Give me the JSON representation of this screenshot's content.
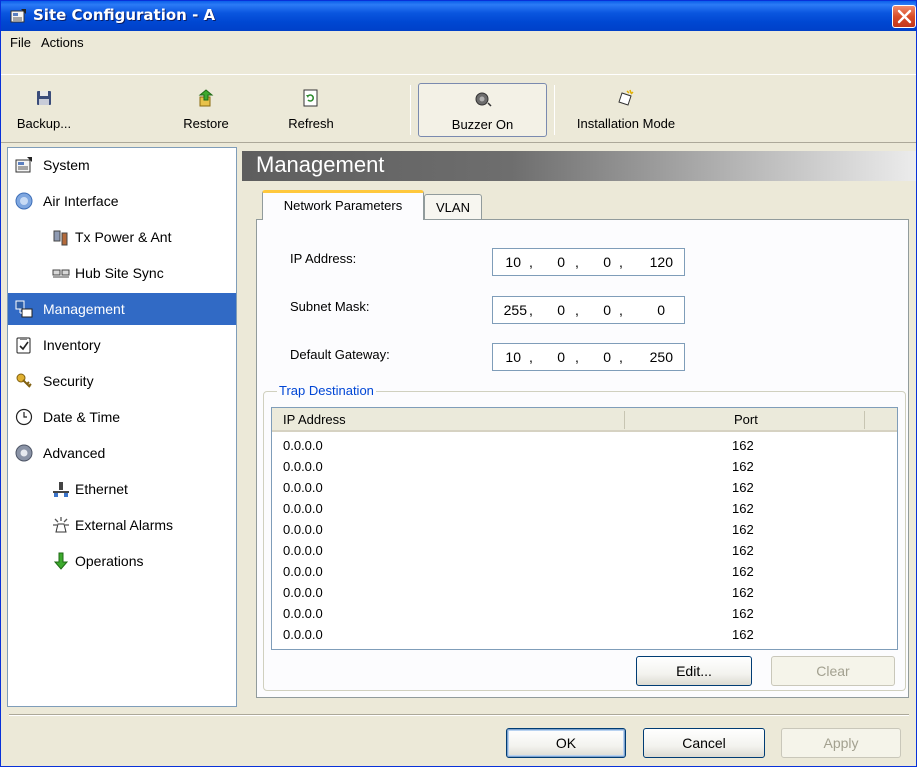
{
  "window": {
    "title": "Site Configuration - A"
  },
  "menu": [
    "File",
    "Actions"
  ],
  "toolbar": {
    "backup": "Backup...",
    "restore": "Restore",
    "refresh": "Refresh",
    "buzzer": "Buzzer On",
    "installation": "Installation Mode"
  },
  "nav": [
    {
      "label": "System",
      "icon": "system-properties-icon"
    },
    {
      "label": "Air Interface",
      "icon": "air-interface-icon"
    },
    {
      "label": "Tx Power & Ant",
      "icon": "antenna-icon"
    },
    {
      "label": "Hub Site Sync",
      "icon": "sync-icon"
    },
    {
      "label": "Management",
      "icon": "management-icon"
    },
    {
      "label": "Inventory",
      "icon": "checklist-icon"
    },
    {
      "label": "Security",
      "icon": "keys-icon"
    },
    {
      "label": "Date & Time",
      "icon": "clock-icon"
    },
    {
      "label": "Advanced",
      "icon": "gear-icon"
    },
    {
      "label": "Ethernet",
      "icon": "ethernet-icon"
    },
    {
      "label": "External Alarms",
      "icon": "alarm-icon"
    },
    {
      "label": "Operations",
      "icon": "arrow-down-icon"
    }
  ],
  "content": {
    "title": "Management",
    "tabs": [
      "Network Parameters",
      "VLAN"
    ],
    "ip_label": "IP Address:",
    "ip": [
      "10",
      "0",
      "0",
      "120"
    ],
    "subnet_label": "Subnet Mask:",
    "subnet": [
      "255",
      "0",
      "0",
      "0"
    ],
    "gateway_label": "Default Gateway:",
    "gateway": [
      "10",
      "0",
      "0",
      "250"
    ],
    "trap": {
      "title": "Trap Destination",
      "columns": [
        "IP Address",
        "Port"
      ],
      "rows": [
        [
          "0.0.0.0",
          "162"
        ],
        [
          "0.0.0.0",
          "162"
        ],
        [
          "0.0.0.0",
          "162"
        ],
        [
          "0.0.0.0",
          "162"
        ],
        [
          "0.0.0.0",
          "162"
        ],
        [
          "0.0.0.0",
          "162"
        ],
        [
          "0.0.0.0",
          "162"
        ],
        [
          "0.0.0.0",
          "162"
        ],
        [
          "0.0.0.0",
          "162"
        ],
        [
          "0.0.0.0",
          "162"
        ]
      ],
      "edit": "Edit...",
      "clear": "Clear"
    }
  },
  "dialog": {
    "ok": "OK",
    "cancel": "Cancel",
    "apply": "Apply"
  },
  "colors": {
    "title_blue": "#0A56DF",
    "selection": "#316AC5",
    "group_title": "#0046D5",
    "tab_highlight": "#FFC83C"
  }
}
